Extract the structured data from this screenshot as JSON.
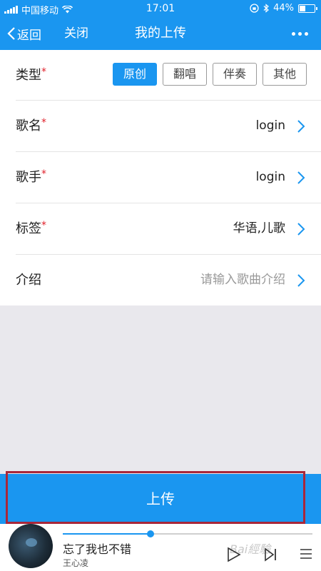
{
  "status": {
    "carrier": "中国移动",
    "time": "17:01",
    "battery": "44%",
    "battery_level": 0.44
  },
  "nav": {
    "back_label": "返回",
    "close_label": "关闭",
    "title": "我的上传",
    "more_icon": "more-dots-icon"
  },
  "form": {
    "type_label": "类型",
    "required_mark": "*",
    "type_options": [
      "原创",
      "翻唱",
      "伴奏",
      "其他"
    ],
    "type_selected": "原创",
    "song_name_label": "歌名",
    "song_name_value": "login",
    "singer_label": "歌手",
    "singer_value": "login",
    "tags_label": "标签",
    "tags_value": "华语,儿歌",
    "intro_label": "介绍",
    "intro_placeholder": "请输入歌曲介绍"
  },
  "upload": {
    "label": "上传"
  },
  "player": {
    "song_title": "忘了我也不错",
    "artist": "王心凌",
    "progress": 0.35
  },
  "watermark": "Bai經驗",
  "colors": {
    "accent": "#1a96f0",
    "required": "#e0202a",
    "highlight_border": "#a8273a"
  }
}
